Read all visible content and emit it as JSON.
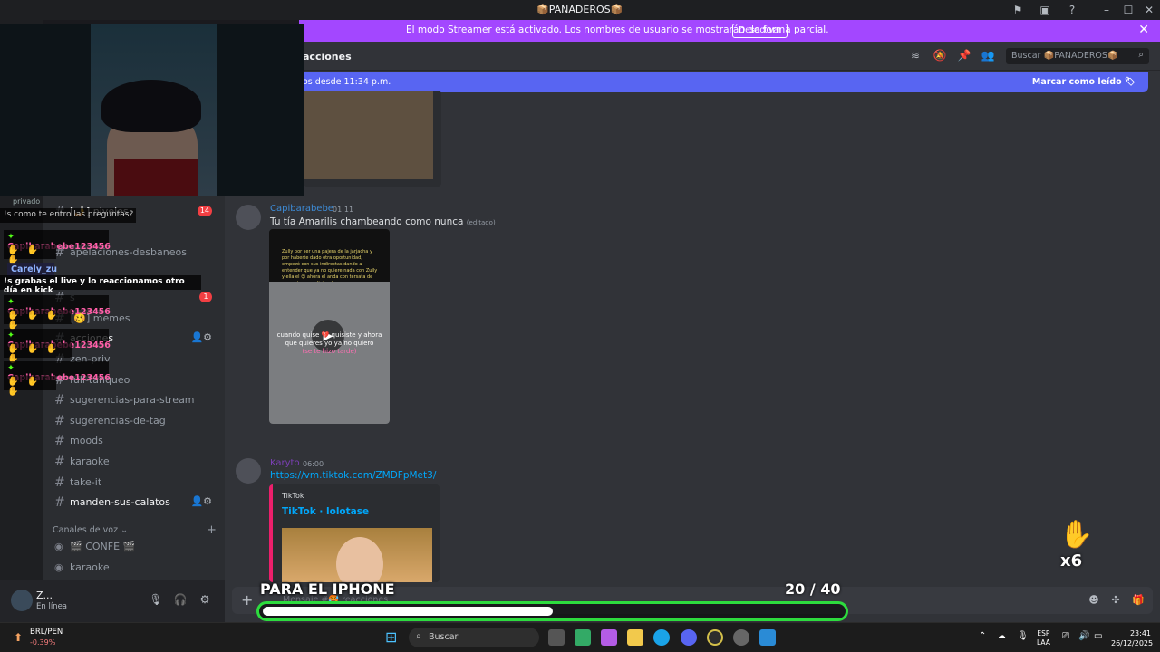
{
  "window": {
    "title": "📦PANADEROS📦",
    "icons": [
      "flag-icon",
      "inbox-icon",
      "help-icon",
      "minimize-icon",
      "maximize-icon",
      "close-icon"
    ]
  },
  "streamer_banner": {
    "message": "El modo Streamer está activado. Los nombres de usuario se mostrarán de forma parcial.",
    "button": "Desactivar",
    "close": "✕"
  },
  "channels": [
    {
      "name": "[🤳] niveles",
      "badge": "14",
      "active": true
    },
    {
      "name": "apelaciones-desbaneos"
    },
    {
      "name": "s",
      "badge": "1"
    },
    {
      "name": "[🥴] memes"
    },
    {
      "name": "acciones",
      "tools": true
    },
    {
      "name": "zen-priv"
    },
    {
      "name": "full-tanqueo"
    },
    {
      "name": "sugerencias-para-stream"
    },
    {
      "name": "sugerencias-de-tag"
    },
    {
      "name": "moods"
    },
    {
      "name": "karaoke"
    },
    {
      "name": "take-it"
    },
    {
      "name": "manden-sus-calatos",
      "active": true,
      "tools": true
    }
  ],
  "voice": {
    "category": "Canales de voz ⌄",
    "add": "+",
    "channels": [
      "🎬 CONFE 🎬",
      "karaoke"
    ]
  },
  "user": {
    "name": "Z...",
    "status": "En línea"
  },
  "chat_header": {
    "title": "acciones",
    "search": "Buscar 📦PANADEROS📦",
    "icons": [
      "threads-icon",
      "mute-icon",
      "pin-icon",
      "members-icon"
    ]
  },
  "new_messages": {
    "text": "os desde 11:34 p.m.",
    "mark_read": "Marcar como leído 🏷"
  },
  "messages": [
    {
      "author": "Capibarabebe",
      "author_color": "#3d8bd6",
      "time": "01:11",
      "text": "Tu tía Amarilis chambeando como nunca",
      "edited": "(editado)",
      "video_top_text": "Zully por ser una pajera de la jarjacha y por haberte dado otra oportunidad, empezó con sus indirectas dando a entender que ya no quiere nada con Zully y ella el 😍 ahora el anda con tersata de nunca tu incondicional",
      "video_caption_1": "cuando quise 💔 quisiste y ahora que quieres yo ya no quiero",
      "video_caption_2": "(se te hizo tarde)"
    },
    {
      "author": "Karyto",
      "author_color": "#7b3fb5",
      "time": "06:00",
      "link": "https://vm.tiktok.com/ZMDFpMet3/",
      "embed_provider": "TikTok",
      "embed_title": "TikTok · lolotase"
    }
  ],
  "composer": {
    "plus": "+",
    "placeholder": "Mensaje #🥵 reacciones"
  },
  "kick_chat": {
    "rows": [
      {
        "type": "text",
        "text": "!s como te entro las preguntas?"
      },
      {
        "type": "name",
        "name": "Capibarabebe123456"
      },
      {
        "type": "emotes",
        "count": 3
      },
      {
        "type": "name",
        "name": "Carely_zu",
        "blue": true
      },
      {
        "type": "text",
        "text": "!s grabas el live y lo reaccionamos otro día en kick"
      },
      {
        "type": "name",
        "name": "Capibarabebe123456"
      },
      {
        "type": "emotes",
        "count": 4
      },
      {
        "type": "name",
        "name": "Capibarabebe123456"
      },
      {
        "type": "emotes",
        "count": 4
      },
      {
        "type": "name",
        "name": "Capibarabebe123456"
      },
      {
        "type": "emotes",
        "count": 3
      }
    ],
    "header_label": "privado"
  },
  "goal": {
    "label": "PARA EL IPHONE",
    "current": 20,
    "target": 40,
    "count_text": "20  / 40",
    "fraction": 0.5
  },
  "reaction_overlay": {
    "multiplier": "x6"
  },
  "taskbar": {
    "fx_pair": "BRL/PEN",
    "fx_change": "-0.39%",
    "search": "Buscar",
    "lang_1": "ESP",
    "lang_2": "LAA",
    "time": "23:41",
    "date": "26/12/2025",
    "colors": {
      "accent_green": "#2ddc3e",
      "discord_blurple": "#5865f2",
      "streamer_purple": "#a347ff"
    }
  }
}
